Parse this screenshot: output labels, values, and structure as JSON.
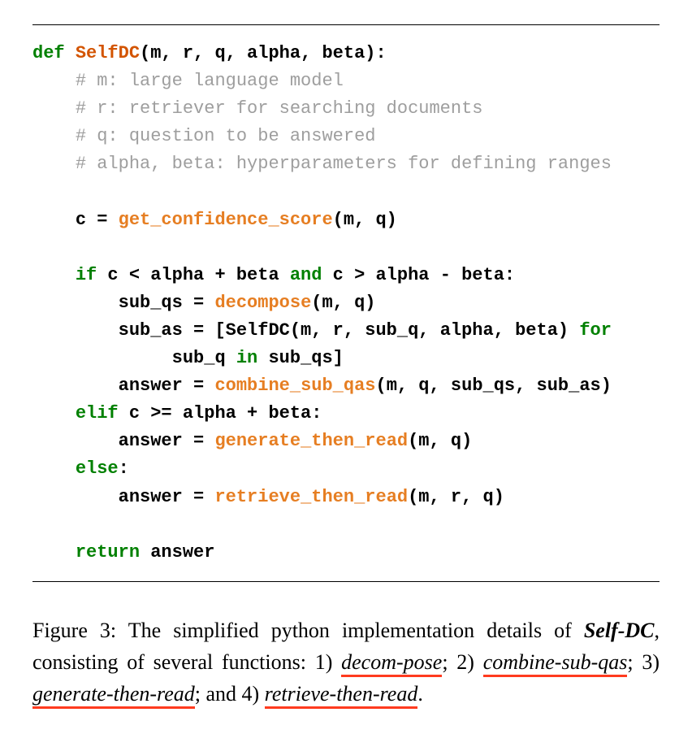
{
  "code": {
    "def": "def",
    "func_name": "SelfDC",
    "params": "(m, r, q, alpha, beta):",
    "c1": "# m: large language model",
    "c2": "# r: retriever for searching documents",
    "c3": "# q: question to be answered",
    "c4": "# alpha, beta: hyperparameters for defining ranges",
    "l_c_eq": "c = ",
    "get_conf": "get_confidence_score",
    "get_conf_args": "(m, q)",
    "if": "if",
    "cond1a": " c < alpha + beta ",
    "and": "and",
    "cond1b": " c > alpha - beta:",
    "subqs_lhs": "sub_qs = ",
    "decompose": "decompose",
    "decompose_args": "(m, q)",
    "subas_lhs": "sub_as = [SelfDC(m, r, sub_q, alpha, beta) ",
    "for": "for",
    "subas_cont": "sub_q ",
    "in": "in",
    "subas_end": " sub_qs]",
    "ans_eq": "answer = ",
    "combine": "combine_sub_qas",
    "combine_args": "(m, q, sub_qs, sub_as)",
    "elif": "elif",
    "cond2": " c >= alpha + beta:",
    "gen_then_read": "generate_then_read",
    "gen_args": "(m, q)",
    "else": "else",
    "colon": ":",
    "ret_then_read": "retrieve_then_read",
    "ret_args": "(m, r, q)",
    "return": "return",
    "return_val": " answer"
  },
  "caption": {
    "prefix": "Figure 3: The simplified python implementation details of ",
    "selfdc": "Self-DC",
    "mid": ", consisting of several functions: 1) ",
    "f1": "decom-pose",
    "sep1": "; 2) ",
    "f2": "combine-sub-qas",
    "sep2": "; 3) ",
    "f3": "generate-then-read",
    "sep3": "; and 4) ",
    "f4": "retrieve-then-read",
    "end": "."
  }
}
